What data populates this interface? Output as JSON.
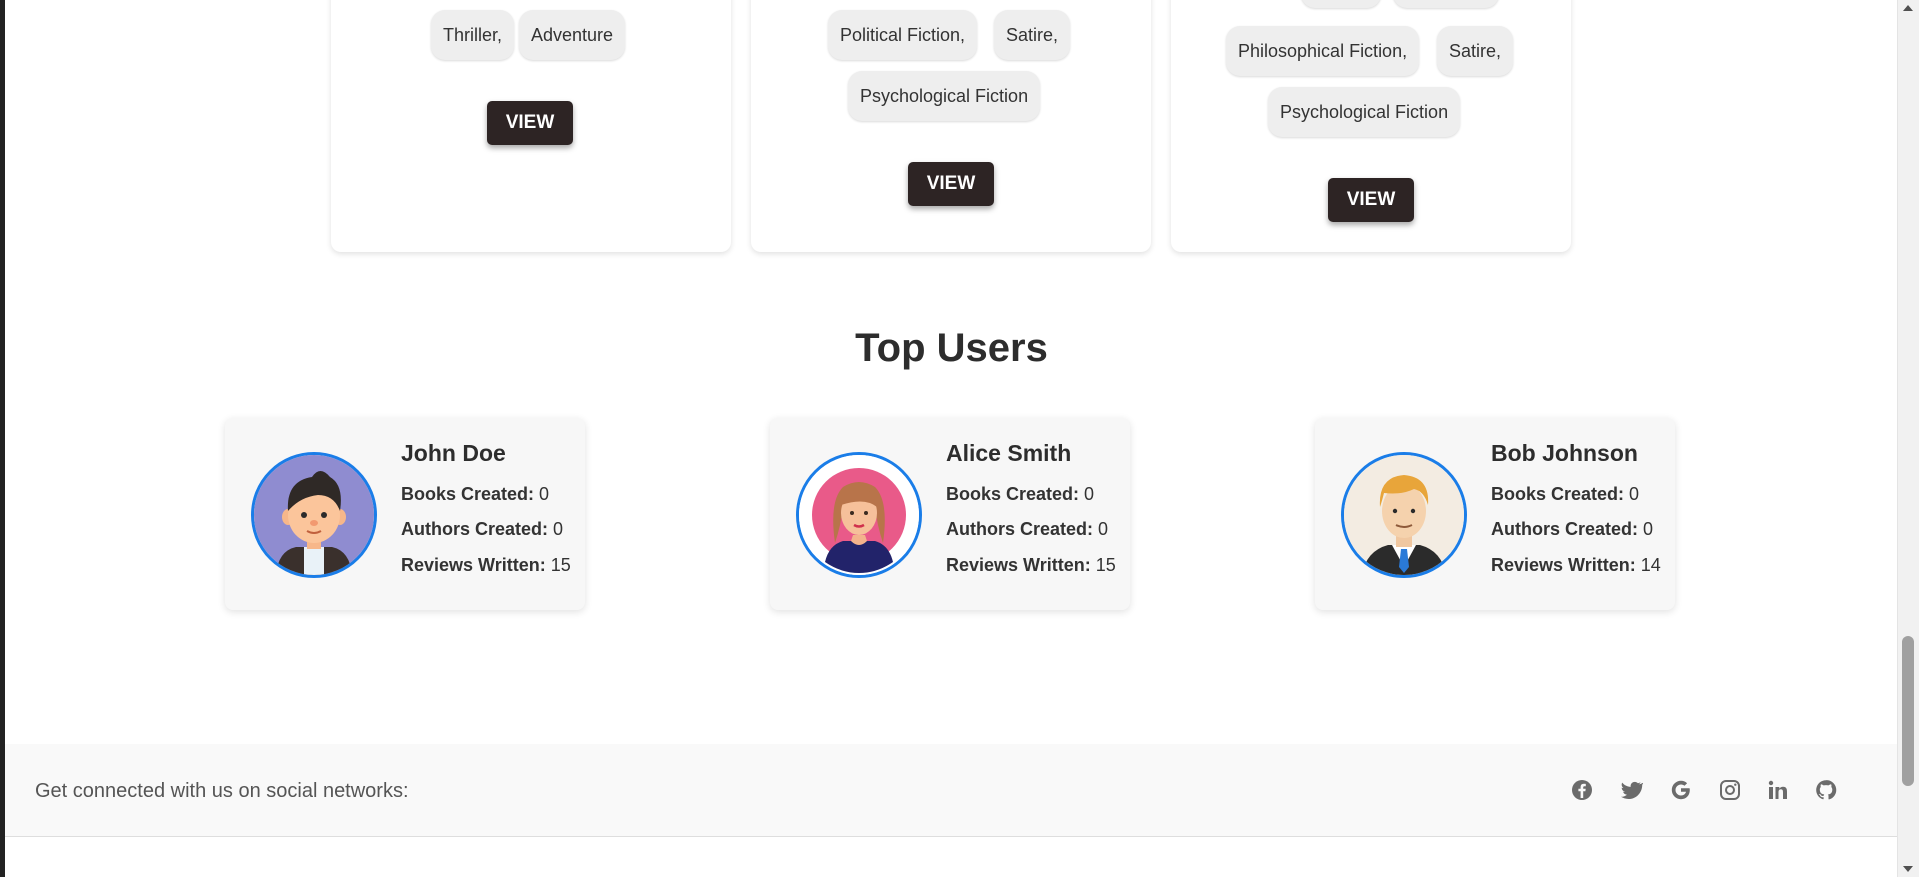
{
  "books": [
    {
      "genres": [
        "Thriller,",
        "Adventure"
      ],
      "view_label": "VIEW"
    },
    {
      "genres": [
        "Political Fiction,",
        "Satire,",
        "Psychological Fiction"
      ],
      "view_label": "VIEW"
    },
    {
      "genres": [
        "Philosophical Fiction,",
        "Satire,",
        "Psychological Fiction"
      ],
      "view_label": "VIEW"
    }
  ],
  "top_users": {
    "title": "Top Users",
    "labels": {
      "books": "Books Created:",
      "authors": "Authors Created:",
      "reviews": "Reviews Written:"
    },
    "users": [
      {
        "name": "John Doe",
        "books_created": "0",
        "authors_created": "0",
        "reviews_written": "15",
        "avatar": "male-cartoon-avatar"
      },
      {
        "name": "Alice Smith",
        "books_created": "0",
        "authors_created": "0",
        "reviews_written": "15",
        "avatar": "female-cartoon-avatar"
      },
      {
        "name": "Bob Johnson",
        "books_created": "0",
        "authors_created": "0",
        "reviews_written": "14",
        "avatar": "businessman-cartoon-avatar"
      }
    ]
  },
  "footer": {
    "text": "Get connected with us on social networks:",
    "icons": [
      "facebook-icon",
      "twitter-icon",
      "google-icon",
      "instagram-icon",
      "linkedin-icon",
      "github-icon"
    ]
  },
  "colors": {
    "button_bg": "#2d2424",
    "avatar_border": "#1a7de8",
    "chip_bg": "#eeeeee"
  }
}
